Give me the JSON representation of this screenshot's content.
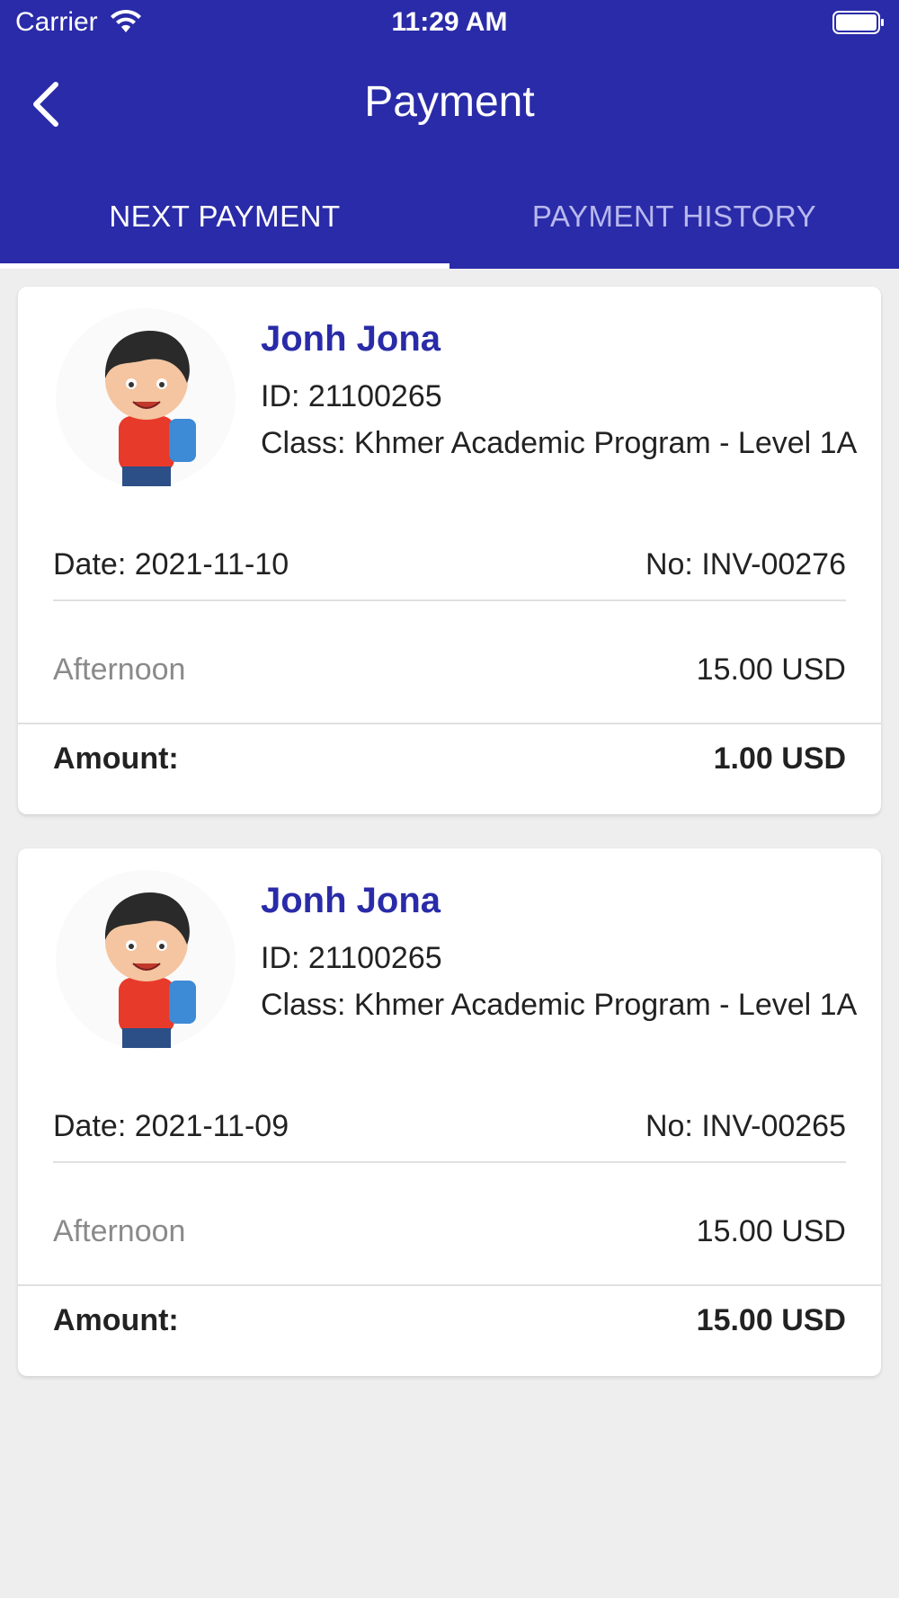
{
  "status_bar": {
    "carrier": "Carrier",
    "time": "11:29 AM"
  },
  "header": {
    "title": "Payment"
  },
  "tabs": [
    {
      "label": "NEXT PAYMENT",
      "active": true
    },
    {
      "label": "PAYMENT HISTORY",
      "active": false
    }
  ],
  "colors": {
    "primary": "#2a2ba8",
    "background": "#eeeeee"
  },
  "payments": [
    {
      "name": "Jonh Jona",
      "student_id": "ID: 21100265",
      "class": "Class: Khmer Academic Program  - Level 1A",
      "date": "Date: 2021-11-10",
      "invoice_no": "No: INV-00276",
      "item": "Afternoon",
      "item_price": "15.00 USD",
      "amount_label": "Amount:",
      "amount": "1.00 USD"
    },
    {
      "name": "Jonh Jona",
      "student_id": "ID: 21100265",
      "class": "Class: Khmer Academic Program  - Level 1A",
      "date": "Date: 2021-11-09",
      "invoice_no": "No: INV-00265",
      "item": "Afternoon",
      "item_price": "15.00 USD",
      "amount_label": "Amount:",
      "amount": "15.00 USD"
    }
  ]
}
